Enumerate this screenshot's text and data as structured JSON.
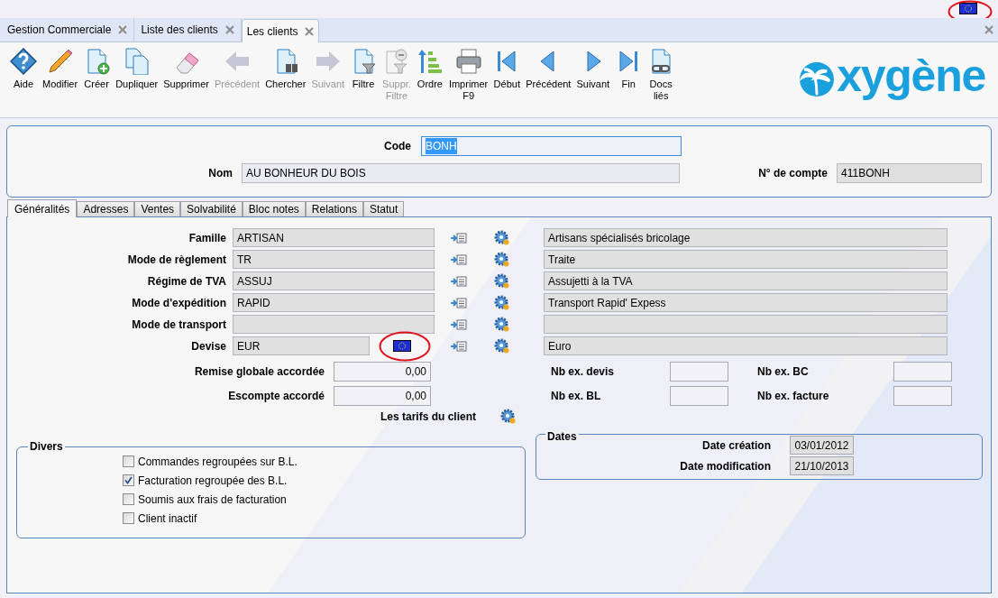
{
  "window_tabs": [
    {
      "label": "Gestion Commerciale",
      "selected": false
    },
    {
      "label": "Liste des clients",
      "selected": false
    },
    {
      "label": "Les clients",
      "selected": true
    }
  ],
  "toolbar": [
    {
      "label": "Aide",
      "kind": "help",
      "disabled": false
    },
    {
      "label": "Modifier",
      "kind": "edit",
      "disabled": false
    },
    {
      "label": "Créer",
      "kind": "create",
      "disabled": false
    },
    {
      "label": "Dupliquer",
      "kind": "duplicate",
      "disabled": false
    },
    {
      "label": "Supprimer",
      "kind": "erase",
      "disabled": false
    },
    {
      "label": "Précédent",
      "kind": "arrow-left",
      "disabled": true
    },
    {
      "label": "Chercher",
      "kind": "search",
      "disabled": false
    },
    {
      "label": "Suivant",
      "kind": "arrow-right",
      "disabled": true
    },
    {
      "label": "Filtre",
      "kind": "filter",
      "disabled": false
    },
    {
      "label": "Suppr. Filtre",
      "kind": "remove-filter",
      "disabled": true
    },
    {
      "label": "Ordre",
      "kind": "sort",
      "disabled": false
    },
    {
      "label": "Imprimer F9",
      "kind": "print",
      "disabled": false
    },
    {
      "label": "Début",
      "kind": "first",
      "disabled": false
    },
    {
      "label": "Précédent",
      "kind": "previous",
      "disabled": false
    },
    {
      "label": "Suivant",
      "kind": "next",
      "disabled": false
    },
    {
      "label": "Fin",
      "kind": "last",
      "disabled": false
    },
    {
      "label": "Docs liés",
      "kind": "linked-docs",
      "disabled": false
    }
  ],
  "logo": {
    "text": "xygène"
  },
  "header": {
    "code": {
      "label": "Code",
      "value": "BONH",
      "highlighted": true
    },
    "nom": {
      "label": "Nom",
      "value": "AU BONHEUR DU BOIS"
    },
    "compte": {
      "label": "N° de compte",
      "value": "411BONH"
    }
  },
  "form_tabs": [
    {
      "label": "Généralités",
      "selected": true
    },
    {
      "label": "Adresses",
      "selected": false
    },
    {
      "label": "Ventes",
      "selected": false
    },
    {
      "label": "Solvabilité",
      "selected": false
    },
    {
      "label": "Bloc notes",
      "selected": false
    },
    {
      "label": "Relations",
      "selected": false
    },
    {
      "label": "Statut",
      "selected": false
    }
  ],
  "fields": [
    {
      "label": "Famille",
      "kind": "lookup",
      "code": "ARTISAN",
      "description": "Artisans spécialisés bricolage"
    },
    {
      "label": "Mode de règlement",
      "kind": "lookup",
      "code": "TR",
      "description": "Traite"
    },
    {
      "label": "Régime de TVA",
      "kind": "lookup",
      "code": "ASSUJ",
      "description": "Assujetti à la TVA"
    },
    {
      "label": "Mode d'expédition",
      "kind": "lookup",
      "code": "RAPID",
      "description": "Transport Rapid' Expess"
    },
    {
      "label": "Mode de transport",
      "kind": "lookup"
    },
    {
      "label": "Devise",
      "kind": "currency",
      "code": "EUR",
      "description": "Euro"
    }
  ],
  "amounts": [
    {
      "label": "Remise globale accordée",
      "value": "0,00"
    },
    {
      "label": "Escompte accordé",
      "value": "0,00"
    }
  ],
  "copies": [
    {
      "label": "Nb ex. devis"
    },
    {
      "label": "Nb ex. BC"
    },
    {
      "label": "Nb ex. BL"
    },
    {
      "label": "Nb ex. facture"
    }
  ],
  "tarifs": {
    "label": "Les tarifs du client"
  },
  "divers": {
    "title": "Divers",
    "options": [
      {
        "label": "Commandes regroupées sur B.L.",
        "checked": false
      },
      {
        "label": "Facturation regroupée des B.L.",
        "checked": true
      },
      {
        "label": "Soumis aux frais de facturation",
        "checked": false
      },
      {
        "label": "Client inactif",
        "checked": false
      }
    ]
  },
  "dates": {
    "title": "Dates",
    "rows": [
      {
        "label": "Date création",
        "value": "03/01/2012"
      },
      {
        "label": "Date modification",
        "value": "21/10/2013"
      }
    ]
  }
}
